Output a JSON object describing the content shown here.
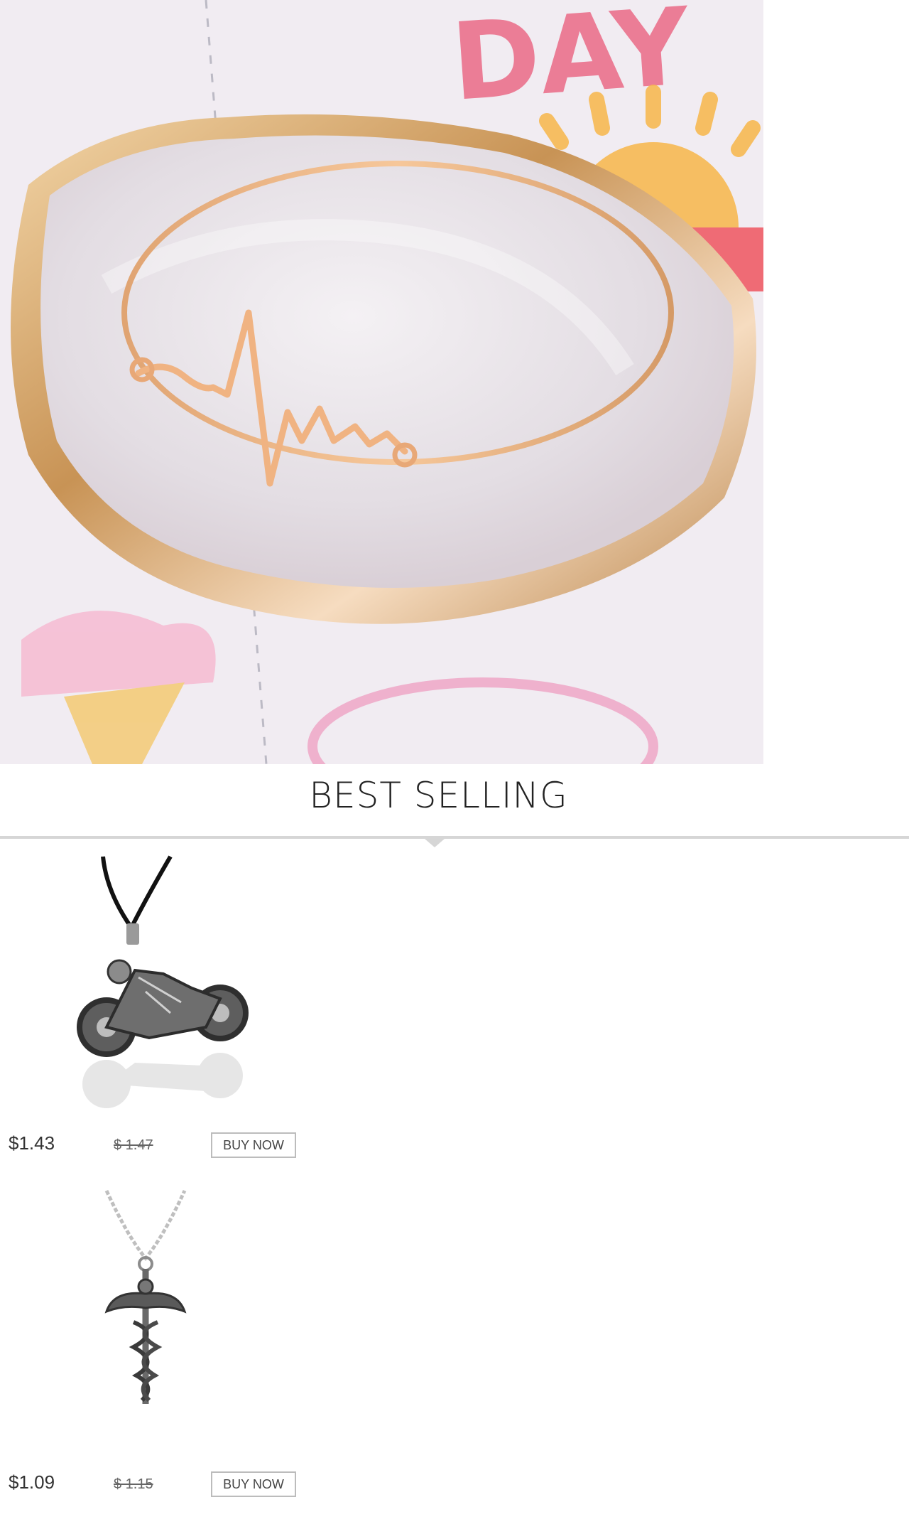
{
  "section": {
    "title": "BEST SELLING"
  },
  "hero": {
    "alt": ""
  },
  "products": [
    {
      "price": "$1.43",
      "old_price": "$ 1.47",
      "button": "BUY NOW",
      "icon": "motorcycle-skeleton-pendant"
    },
    {
      "price": "$1.09",
      "old_price": "$ 1.15",
      "button": "BUY NOW",
      "icon": "caduceus-pendant"
    }
  ],
  "colors": {
    "gold": "#d9a46e",
    "divider": "#d6d6d6"
  }
}
